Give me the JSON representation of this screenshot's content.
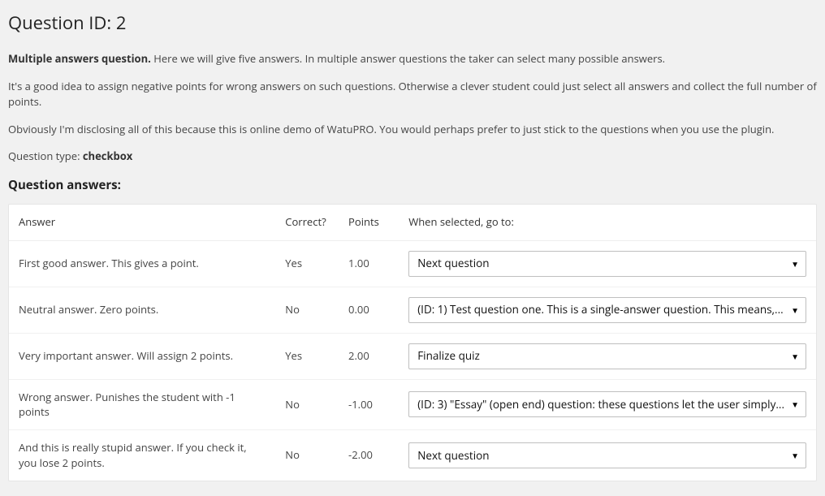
{
  "page": {
    "title": "Question ID: 2",
    "intro_strong": "Multiple answers question.",
    "intro_rest": " Here we will give five answers. In multiple answer questions the taker can select many possible answers.",
    "para2": "It's a good idea to assign negative points for wrong answers on such questions. Otherwise a clever student could just select all answers and collect the full number of points.",
    "para3": "Obviously I'm disclosing all of this because this is online demo of WatuPRO. You would perhaps prefer to just stick to the questions when you use the plugin.",
    "qtype_label": "Question type: ",
    "qtype_value": "checkbox",
    "answers_heading": "Question answers:"
  },
  "table": {
    "headers": {
      "answer": "Answer",
      "correct": "Correct?",
      "points": "Points",
      "goto": "When selected, go to:"
    },
    "rows": [
      {
        "answer": "First good answer. This gives a point.",
        "correct": "Yes",
        "points": "1.00",
        "goto": "Next question"
      },
      {
        "answer": "Neutral answer. Zero points.",
        "correct": "No",
        "points": "0.00",
        "goto": "(ID: 1) Test question one. This is a single-answer question. This means,..."
      },
      {
        "answer": "Very important answer. Will assign 2 points.",
        "correct": "Yes",
        "points": "2.00",
        "goto": "Finalize quiz"
      },
      {
        "answer": "Wrong answer. Punishes the student with -1 points",
        "correct": "No",
        "points": "-1.00",
        "goto": "(ID: 3) \"Essay\" (open end) question: these questions let the user simply..."
      },
      {
        "answer": "And this is really stupid answer. If you check it, you lose 2 points.",
        "correct": "No",
        "points": "-2.00",
        "goto": "Next question"
      }
    ]
  }
}
